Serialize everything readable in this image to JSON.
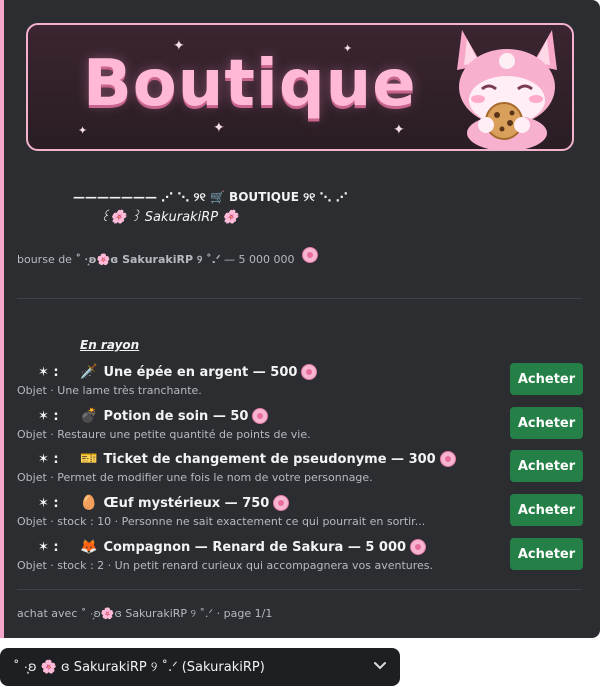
{
  "banner": {
    "title": "Boutique"
  },
  "header": {
    "line1": "———————  ⋰ ⋱ ୨୧ 🛒 BOUTIQUE ୨୧ ⋱ ⋰",
    "line2": "꒰🌸 ꒱ SakurakiRP 🌸"
  },
  "bourse": {
    "prefix": "bourse de",
    "name": "˚ ·͙ʚ🌸ɞ SakurakiRP ୨ ˚.ᐟ",
    "amount": "— 5 000 000"
  },
  "section": {
    "title": "En rayon"
  },
  "items": [
    {
      "bullet": "✶  :",
      "emoji": "🗡️",
      "name": "Une épée en argent — 500",
      "desc": "Objet · Une lame très tranchante.",
      "button": "Acheter"
    },
    {
      "bullet": "✶  :",
      "emoji": "💣",
      "name": "Potion de soin — 50",
      "desc": "Objet · Restaure une petite quantité de points de vie.",
      "button": "Acheter"
    },
    {
      "bullet": "✶  :",
      "emoji": "🎫",
      "name": "Ticket de changement de pseudonyme — 300",
      "desc": "Objet · Permet de modifier une fois le nom de votre personnage.",
      "button": "Acheter"
    },
    {
      "bullet": "✶  :",
      "emoji": "🥚",
      "name": "Œuf mystérieux — 750",
      "desc": "Objet · stock : 10 · Personne ne sait exactement ce qui pourrait en sortir...",
      "button": "Acheter"
    },
    {
      "bullet": "✶  :",
      "emoji": "🦊",
      "name": "Compagnon — Renard de Sakura — 5 000",
      "desc": "Objet · stock : 2 · Un petit renard curieux qui accompagnera vos aventures.",
      "button": "Acheter"
    }
  ],
  "footer": {
    "text": "achat avec ˚ ·͙ʚ🌸ɞ SakurakiRP ୨ ˚.ᐟ · page 1/1"
  },
  "select": {
    "value": "˚ ·͙ʚ 🌸 ɞ SakurakiRP ୨ ˚.ᐟ (SakurakiRP)"
  },
  "colors": {
    "accent": "#f4a6c8",
    "button": "#248046",
    "card": "#2b2d31"
  },
  "icons": {
    "coin": "sakura-coin-icon",
    "chevron": "chevron-down-icon"
  }
}
